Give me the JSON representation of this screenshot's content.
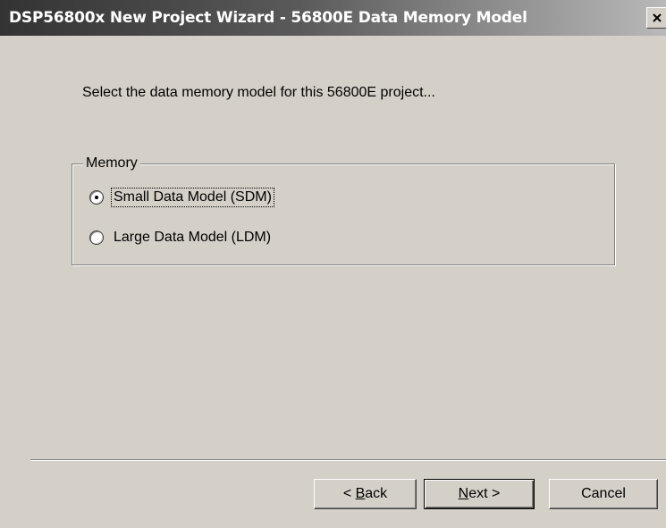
{
  "window": {
    "title": "DSP56800x New Project Wizard - 56800E Data Memory Model",
    "close_icon": "close-icon"
  },
  "instruction": "Select the data memory model for this 56800E project...",
  "memory_group": {
    "label": "Memory",
    "options": [
      {
        "label": "Small Data Model (SDM)",
        "selected": true
      },
      {
        "label": "Large Data Model (LDM)",
        "selected": false
      }
    ]
  },
  "buttons": {
    "back": {
      "prefix": "< ",
      "mnemonic": "B",
      "rest": "ack"
    },
    "next": {
      "mnemonic": "N",
      "rest": "ext >"
    },
    "cancel": "Cancel"
  }
}
